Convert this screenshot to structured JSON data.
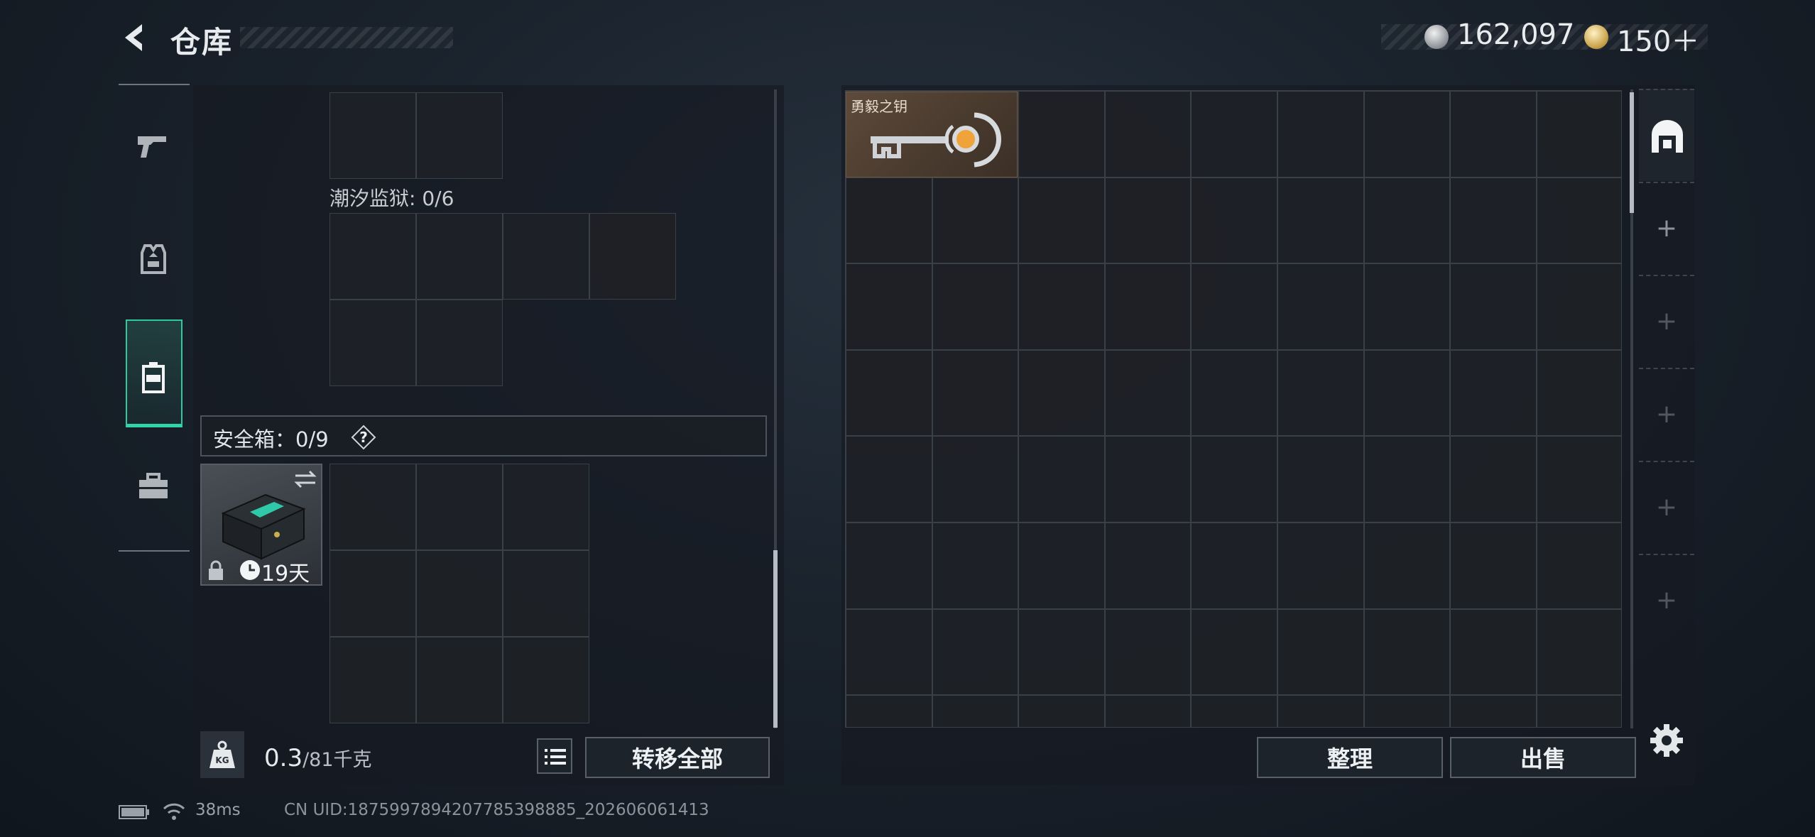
{
  "header": {
    "title": "仓库",
    "currency_silver": "162,097",
    "currency_gold": "150＋"
  },
  "sidebar": {
    "items": [
      {
        "icon": "pistol-icon"
      },
      {
        "icon": "armor-vest-icon"
      },
      {
        "icon": "backpack-icon",
        "active": true
      },
      {
        "icon": "toolbox-icon"
      }
    ]
  },
  "loadout": {
    "section_label": "潮汐监狱: 0/6",
    "safe_box_label": "安全箱：0/9",
    "help_symbol": "?",
    "safe_box_days": "19天",
    "weight_current": "0.3",
    "weight_max": "/81千克",
    "transfer_all_label": "转移全部"
  },
  "stash": {
    "key_item_name": "勇毅之钥",
    "sort_label": "整理",
    "sell_label": "出售"
  },
  "right_tabs": {
    "plus_symbol": "+"
  },
  "status": {
    "ping": "38ms",
    "uid": "CN UID:1875997894207785398885_202606061413"
  },
  "colors": {
    "accent": "#30d3aa",
    "key_bg": "#5d4a3a"
  }
}
